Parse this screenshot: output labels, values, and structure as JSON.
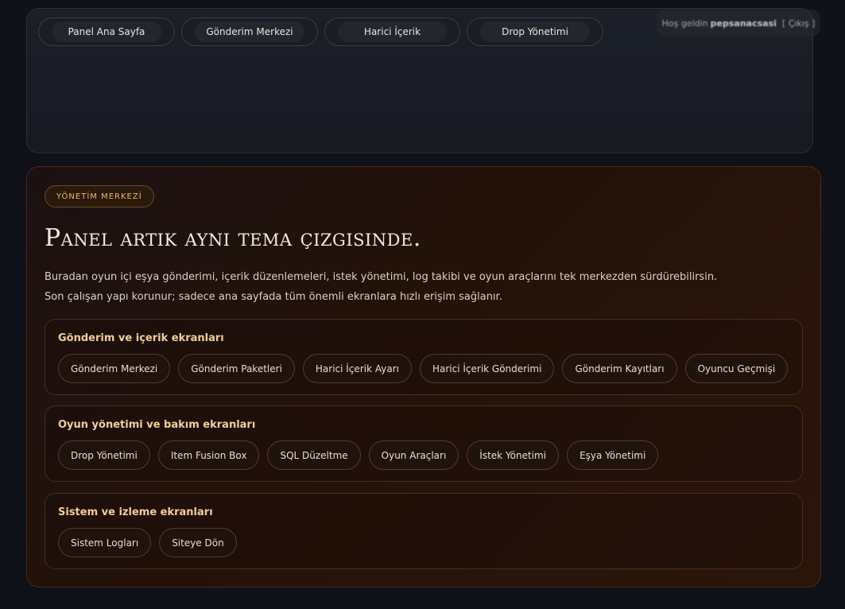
{
  "nav": {
    "items": [
      {
        "label": "Panel Ana Sayfa"
      },
      {
        "label": "Gönderim Merkezi"
      },
      {
        "label": "Harici İçerik"
      },
      {
        "label": "Drop Yönetimi"
      }
    ]
  },
  "user": {
    "greeting": "Hoş geldin",
    "name": "pepsanacsasi",
    "logout_label": "[ Çıkış ]"
  },
  "hero": {
    "eyebrow": "YÖNETİM MERKEZİ",
    "title": "Panel artık aynı tema çizgisinde.",
    "description_line1": "Buradan oyun içi eşya gönderimi, içerik düzenlemeleri, istek yönetimi, log takibi ve oyun araçlarını tek merkezden sürdürebilirsin.",
    "description_line2": "Son çalışan yapı korunur; sadece ana sayfada tüm önemli ekranlara hızlı erişim sağlanır."
  },
  "groups": [
    {
      "title": "Gönderim ve içerik ekranları",
      "links": [
        "Gönderim Merkezi",
        "Gönderim Paketleri",
        "Harici İçerik Ayarı",
        "Harici İçerik Gönderimi",
        "Gönderim Kayıtları",
        "Oyuncu Geçmişi"
      ]
    },
    {
      "title": "Oyun yönetimi ve bakım ekranları",
      "links": [
        "Drop Yönetimi",
        "Item Fusion Box",
        "SQL Düzeltme",
        "Oyun Araçları",
        "İstek Yönetimi",
        "Eşya Yönetimi"
      ]
    },
    {
      "title": "Sistem ve izleme ekranları",
      "links": [
        "Sistem Logları",
        "Siteye Dön"
      ]
    }
  ]
}
